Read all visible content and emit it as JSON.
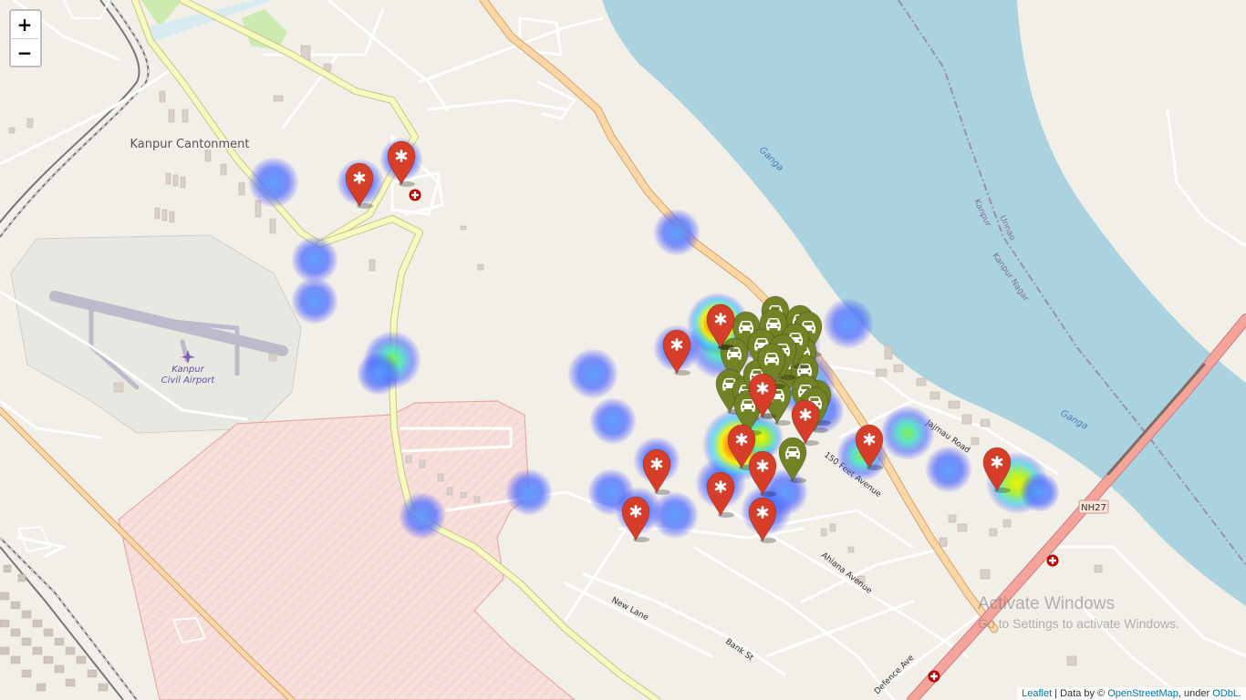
{
  "map": {
    "zoom_in_label": "+",
    "zoom_out_label": "−",
    "place_labels": {
      "kanpur_cantonment": "Kanpur Cantonment",
      "airport_line1": "Kanpur",
      "airport_line2": "Civil Airport",
      "ganga_1": "Ganga",
      "ganga_2": "Ganga",
      "kanpur_boundary": "Kanpur",
      "unnao": "Unnao",
      "kanpur_nagar": "Kanpur Nagar",
      "road_150ft": "150 Feet Avenue",
      "jajmau_road": "Jajmau Road",
      "ahiana_avenue": "Ahiana Avenue",
      "new_lane": "New Lane",
      "bank_st": "Bank St",
      "defence_ave": "Defence Ave",
      "nh27": "NH27"
    },
    "colors": {
      "hospital_marker": "#d63e2a",
      "car_marker": "#728224",
      "water": "#aad3df",
      "land": "#f2efe9",
      "military_area": "#f7d9d6",
      "trunk_road": "#fcd6a4",
      "primary_road": "#f7fabf",
      "motorway": "#e892a2"
    },
    "marker_icons": {
      "hospital": "asterisk-icon",
      "car": "car-icon",
      "health_poi": "red-cross-icon"
    },
    "marker_counts": {
      "hospital_markers": 15,
      "car_markers": 24
    }
  },
  "attribution": {
    "leaflet": "Leaflet",
    "data_by": " | Data by © ",
    "osm": "OpenStreetMap",
    "under": ", under ",
    "odbl": "ODbL."
  },
  "watermark": {
    "line1": "Activate Windows",
    "line2": "Go to Settings to activate Windows."
  }
}
